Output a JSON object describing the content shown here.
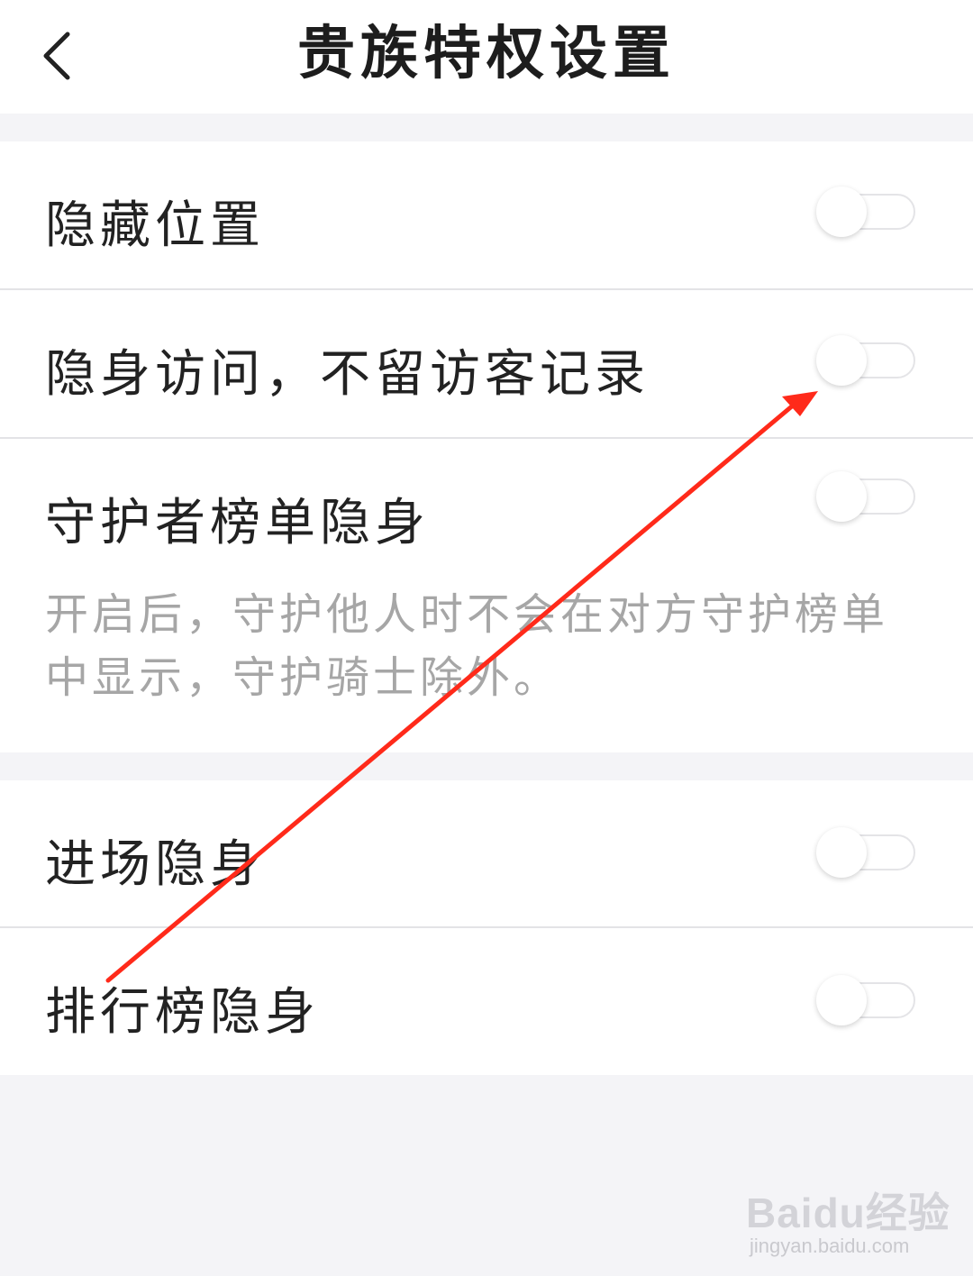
{
  "header": {
    "back_icon": "chevron-left-icon",
    "title": "贵族特权设置"
  },
  "settings": [
    {
      "label": "隐藏位置",
      "enabled": false
    },
    {
      "label": "隐身访问，不留访客记录",
      "enabled": false
    },
    {
      "label": "守护者榜单隐身",
      "enabled": false,
      "description": "开启后，守护他人时不会在对方守护榜单中显示，守护骑士除外。"
    },
    {
      "label": "进场隐身",
      "enabled": false
    },
    {
      "label": "排行榜隐身",
      "enabled": false
    }
  ],
  "annotation": {
    "arrow_color": "#ff2a1a"
  },
  "watermark": {
    "brand": "Baidu经验",
    "url": "jingyan.baidu.com"
  }
}
